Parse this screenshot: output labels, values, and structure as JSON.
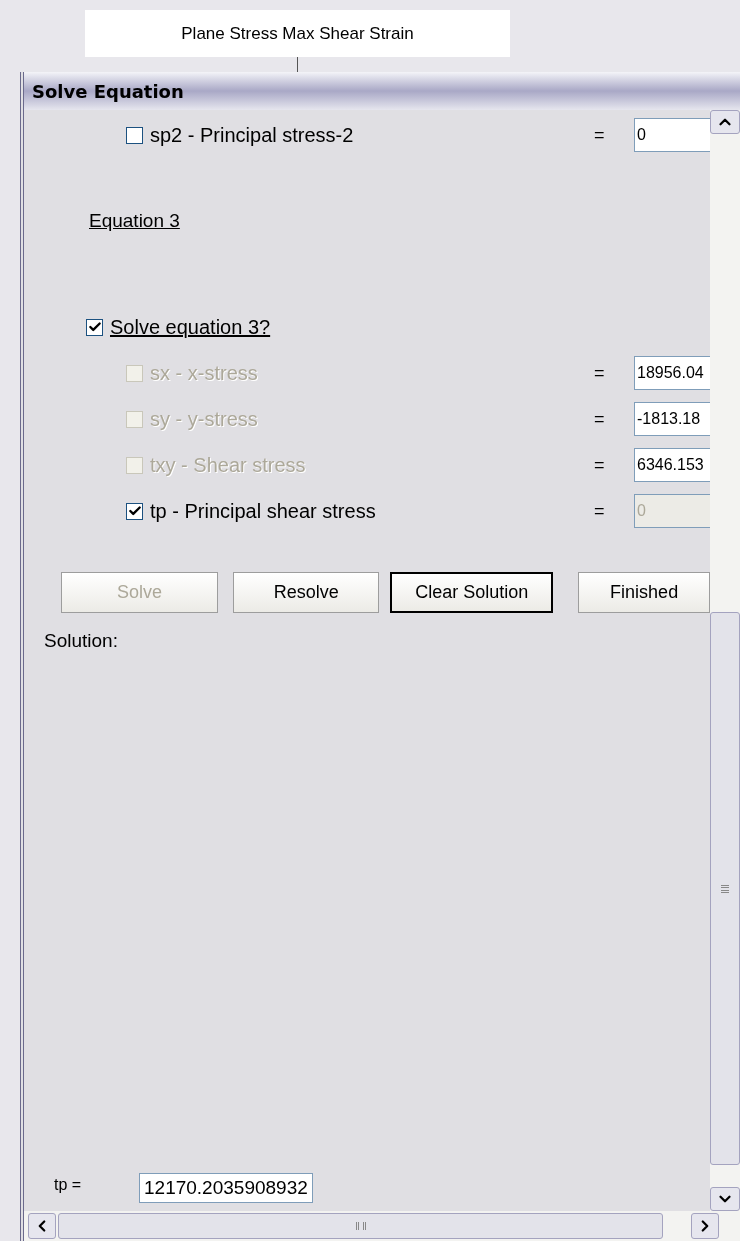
{
  "diagram_node": {
    "title": "Plane Stress Max Shear Strain"
  },
  "window": {
    "title": "Solve Equation"
  },
  "top_row": {
    "label": "sp2 - Principal stress-2",
    "checked": false,
    "disabled": false,
    "value": "0"
  },
  "section_heading": "Equation 3",
  "solve_toggle": {
    "label": "Solve equation 3?",
    "checked": true
  },
  "rows": [
    {
      "label": "sx - x-stress",
      "checked": false,
      "disabled": true,
      "value": "18956.04",
      "value_disabled": false
    },
    {
      "label": "sy - y-stress",
      "checked": false,
      "disabled": true,
      "value": "-1813.18",
      "value_disabled": false
    },
    {
      "label": "txy - Shear stress",
      "checked": false,
      "disabled": true,
      "value": "6346.153",
      "value_disabled": false
    },
    {
      "label": "tp - Principal shear stress",
      "checked": true,
      "disabled": false,
      "value": "0",
      "value_disabled": true
    }
  ],
  "equals_sign": "=",
  "buttons": [
    {
      "label": "Solve",
      "disabled": true,
      "default": false
    },
    {
      "label": "Resolve",
      "disabled": false,
      "default": false
    },
    {
      "label": "Clear Solution",
      "disabled": false,
      "default": true
    },
    {
      "label": "Finished",
      "disabled": false,
      "default": false
    }
  ],
  "solution_label": "Solution:",
  "result": {
    "label": "tp =",
    "value": "12170.2035908932"
  }
}
